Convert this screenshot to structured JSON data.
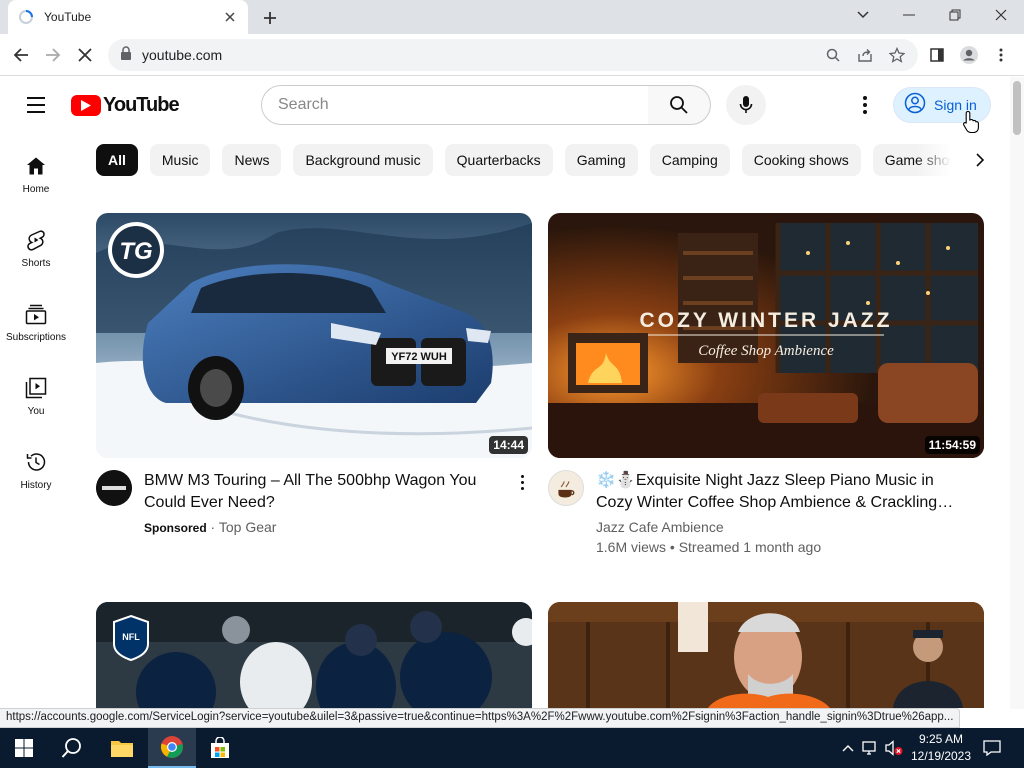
{
  "browser": {
    "tab_title": "YouTube",
    "url": "youtube.com"
  },
  "header": {
    "logo_text": "YouTube",
    "search_placeholder": "Search",
    "signin_label": "Sign in"
  },
  "chips": [
    "All",
    "Music",
    "News",
    "Background music",
    "Quarterbacks",
    "Gaming",
    "Camping",
    "Cooking shows",
    "Game shows"
  ],
  "sidebar": {
    "items": [
      {
        "label": "Home",
        "icon": "home-icon"
      },
      {
        "label": "Shorts",
        "icon": "shorts-icon"
      },
      {
        "label": "Subscriptions",
        "icon": "subscriptions-icon"
      },
      {
        "label": "You",
        "icon": "you-icon"
      },
      {
        "label": "History",
        "icon": "history-icon"
      }
    ]
  },
  "videos": [
    {
      "title": "BMW M3 Touring – All The 500bhp Wagon You Could Ever Need?",
      "duration": "14:44",
      "sponsored": "Sponsored",
      "channel": "Top Gear",
      "channel_sep": " · ",
      "thumb_badge": "TG",
      "plate": "YF72 WUH"
    },
    {
      "title": "❄️⛄Exquisite Night Jazz Sleep Piano Music in Cozy Winter Coffee Shop Ambience & Crackling…",
      "duration": "11:54:59",
      "channel": "Jazz Cafe Ambience",
      "stats": "1.6M views • Streamed 1 month ago",
      "thumb_heading": "COZY WINTER JAZZ",
      "thumb_sub": "Coffee Shop Ambience"
    },
    {
      "title": "",
      "thumb_badge": "NFL"
    },
    {
      "title": ""
    }
  ],
  "status_url": "https://accounts.google.com/ServiceLogin?service=youtube&uilel=3&passive=true&continue=https%3A%2F%2Fwww.youtube.com%2Fsignin%3Faction_handle_signin%3Dtrue%26app...",
  "taskbar": {
    "time": "9:25 AM",
    "date": "12/19/2023"
  },
  "colors": {
    "brand_red": "#ff0000",
    "signin_blue": "#065fd4",
    "chip_active": "#0f0f0f"
  }
}
